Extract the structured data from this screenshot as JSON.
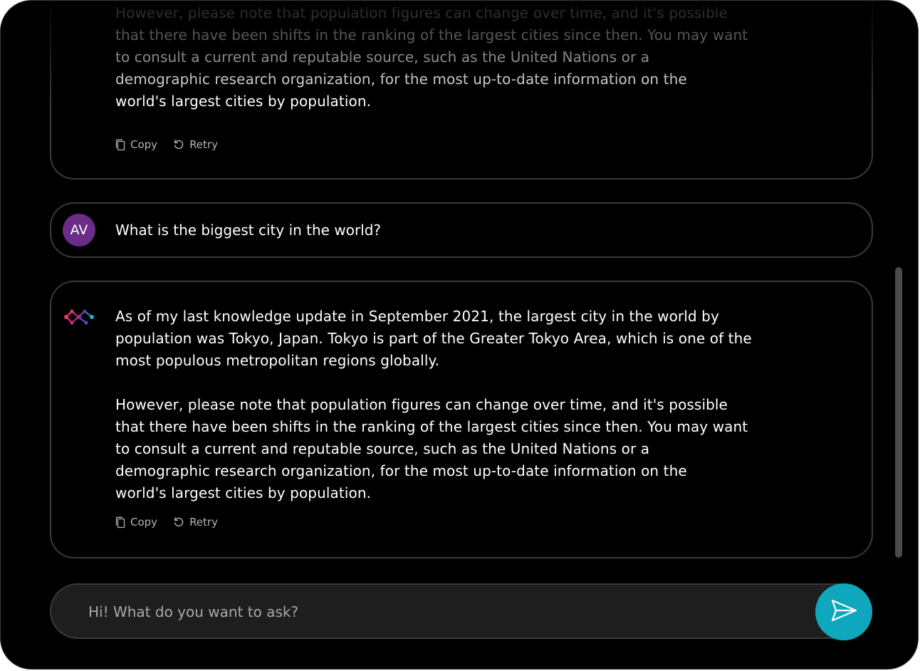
{
  "previous_reply": {
    "text": "However, please note that population figures can change over time, and it's possible\nthat there have been shifts in the ranking of the largest cities since then. You may want\nto consult a current and reputable source, such as the United Nations or a\ndemographic research organization, for the most up-to-date information on the\nworld's largest cities by population.",
    "copy_label": "Copy",
    "retry_label": "Retry"
  },
  "user_message": {
    "avatar_initials": "AV",
    "text": "What is the biggest city in the world?"
  },
  "assistant_reply": {
    "text": "As of my last knowledge update in September 2021, the largest city in the world by\npopulation was Tokyo, Japan. Tokyo is part of the Greater Tokyo Area, which is one of the\nmost populous metropolitan regions globally.\n\nHowever, please note that population figures can change over time, and it's possible\nthat there have been shifts in the ranking of the largest cities since then. You may want\nto consult a current and reputable source, such as the United Nations or a\ndemographic research organization, for the most up-to-date information on the\nworld's largest cities by population.",
    "copy_label": "Copy",
    "retry_label": "Retry"
  },
  "composer": {
    "placeholder": "Hi! What do you want to ask?"
  },
  "icons": {
    "copy": "copy-icon",
    "retry": "retry-icon",
    "send": "send-icon",
    "bot_logo": "bot-logo-icon"
  },
  "colors": {
    "background": "#000000",
    "card_border": "#3a3a3a",
    "avatar": "#6a2c86",
    "send_button": "#0ea7bd",
    "composer_bg": "#1e1e1e"
  }
}
